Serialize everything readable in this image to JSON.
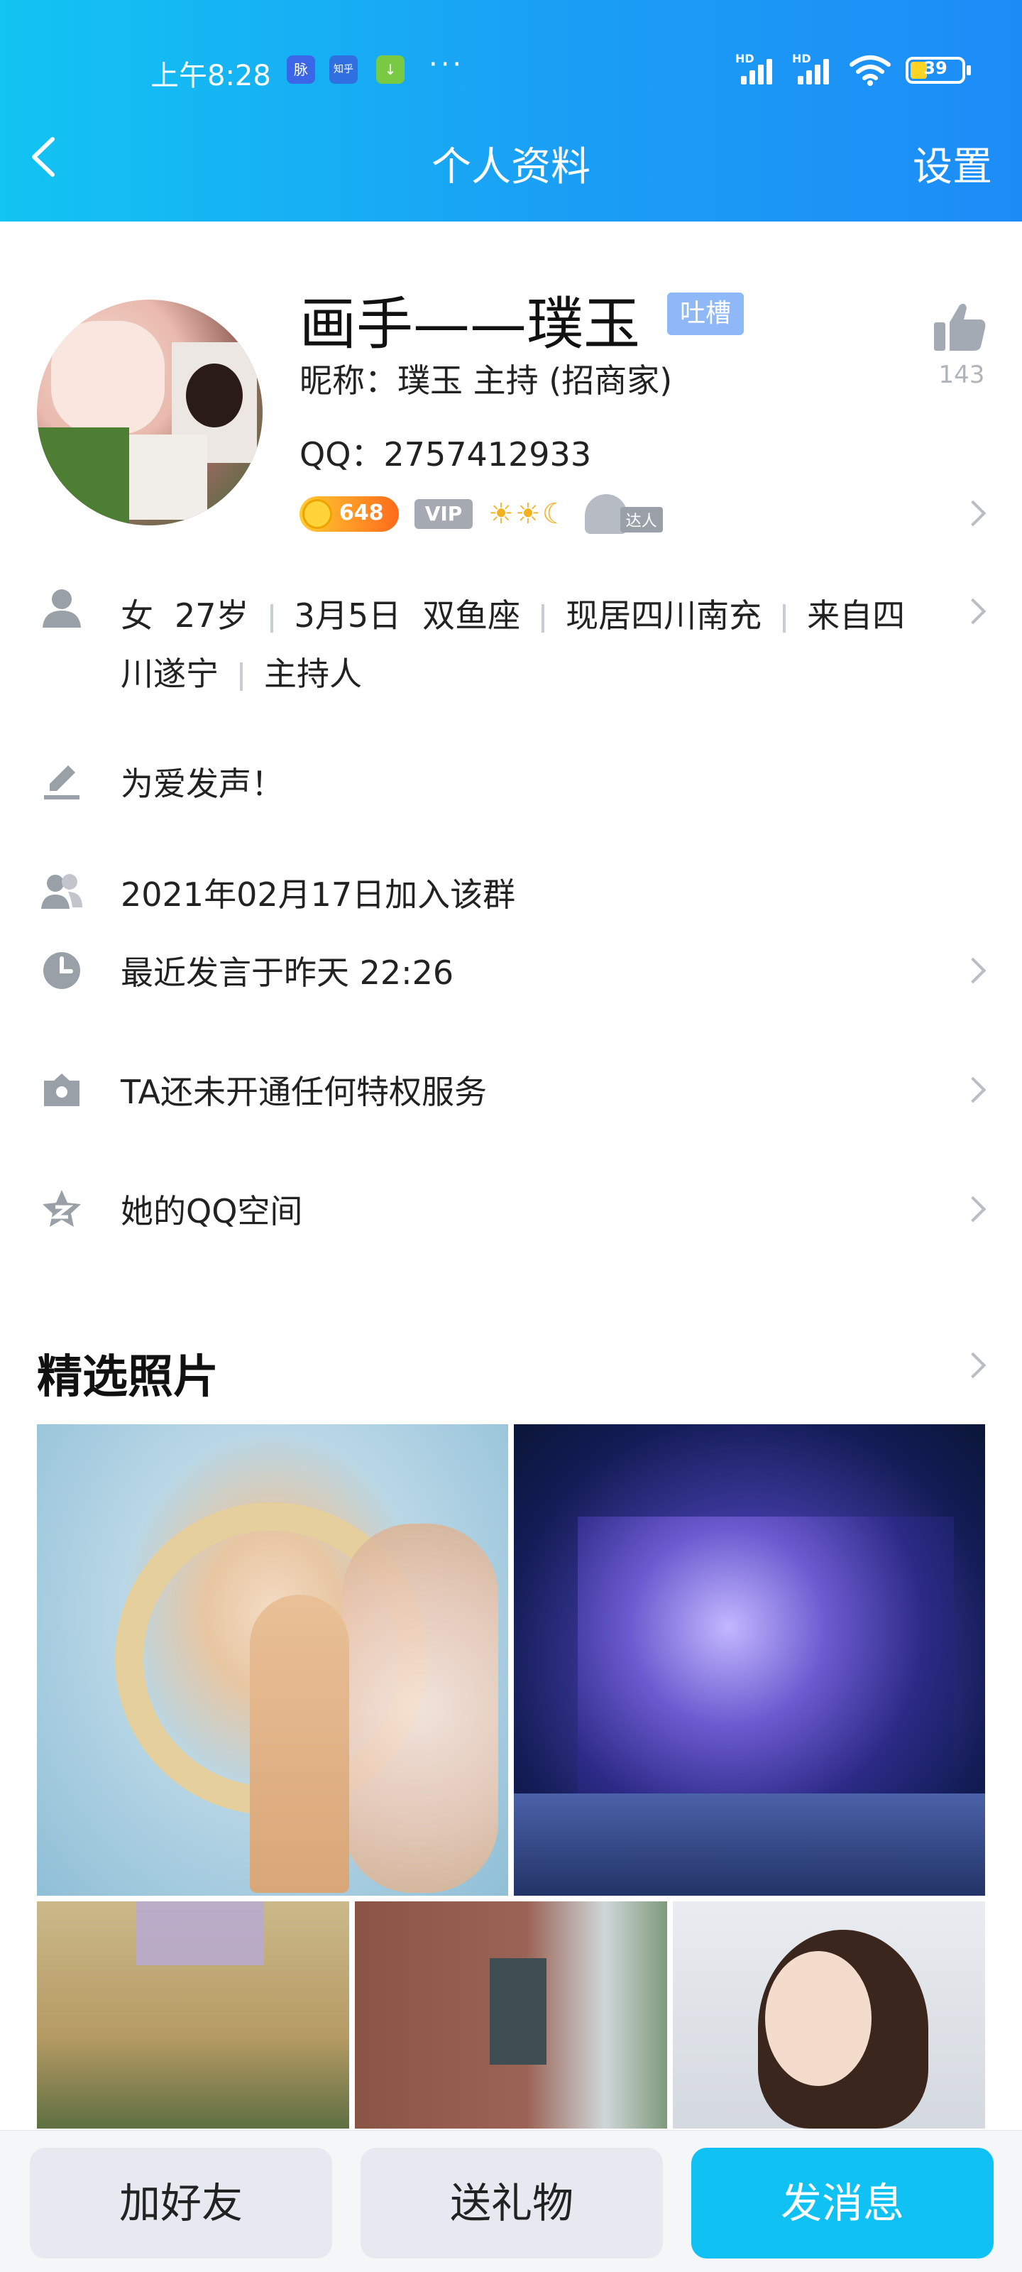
{
  "status_bar": {
    "time": "上午8:28",
    "apps": [
      "脉",
      "知乎",
      "↓"
    ],
    "dots": "···",
    "signal1_label": "HD",
    "signal2_label": "HD",
    "battery": "39"
  },
  "nav": {
    "title": "个人资料",
    "settings": "设置"
  },
  "profile": {
    "name": "画手——璞玉",
    "tag": "吐槽",
    "nickname": "昵称：璞玉  主持 (招商家)",
    "qq": "QQ：2757412933",
    "like_count": "143",
    "coin_value": "648",
    "vip_label": "VIP",
    "level_icons": "☀☀☾",
    "daren_label": "达人"
  },
  "info": {
    "gender": "女",
    "age": "27岁",
    "birthday": "3月5日",
    "zodiac": "双鱼座",
    "location": "现居四川南充",
    "hometown": "来自四川遂宁",
    "profession": "主持人",
    "signature": "为爱发声！",
    "joined": "2021年02月17日加入该群",
    "last_spoke": "最近发言于昨天 22:26",
    "privilege": "TA还未开通任何特权服务",
    "qzone": "她的QQ空间"
  },
  "photos": {
    "title": "精选照片"
  },
  "actions": {
    "add_friend": "加好友",
    "send_gift": "送礼物",
    "send_message": "发消息"
  },
  "colors": {
    "header_start": "#12c4f2",
    "header_end": "#1d8cf7",
    "tag_bg": "#8fb8f8",
    "primary_button": "#0fc2f3"
  },
  "icons": {
    "back": "chevron-left-icon",
    "like": "thumbs-up-icon",
    "person": "person-icon",
    "signature": "pencil-icon",
    "group": "group-icon",
    "clock": "clock-icon",
    "privilege": "crown-icon",
    "qzone": "star-icon"
  }
}
